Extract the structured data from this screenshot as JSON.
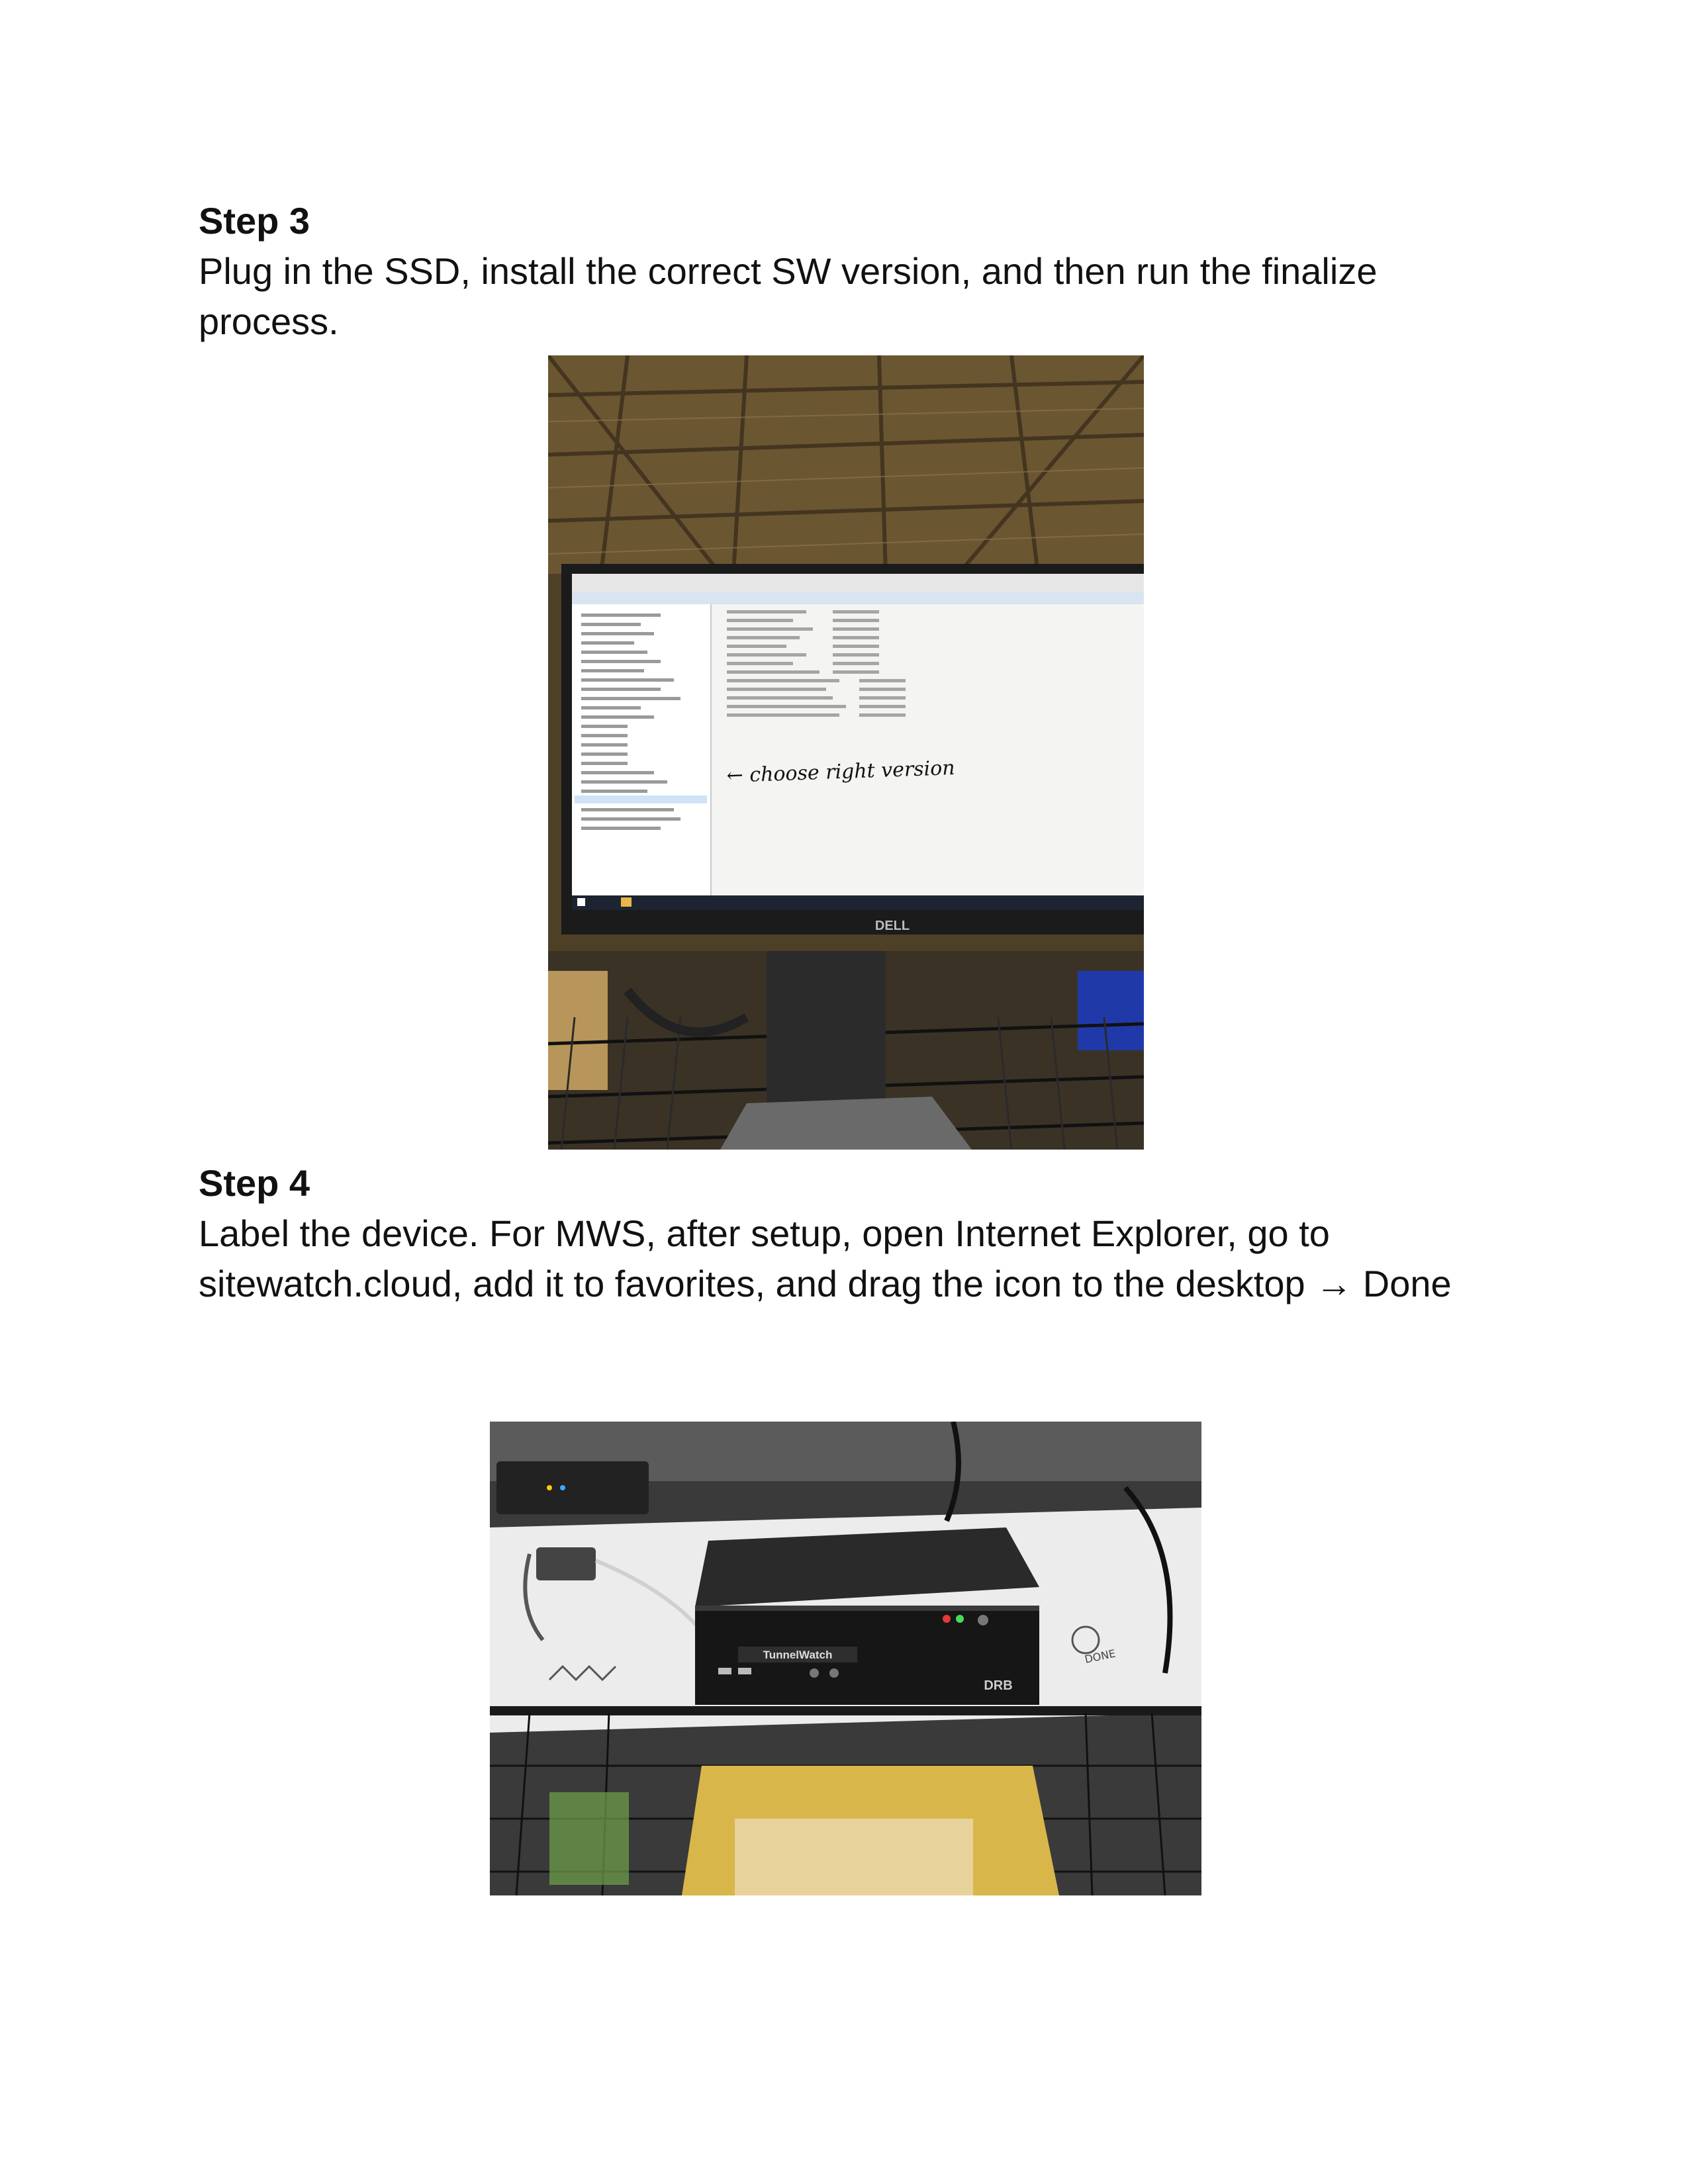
{
  "step3": {
    "heading": "Step 3",
    "text": "Plug in the SSD, install the correct SW version, and then run the finalize process.",
    "photo": {
      "annotation": "← choose right version",
      "monitor_brand": "DELL"
    }
  },
  "step4": {
    "heading": "Step 4",
    "text": "Label the device. For MWS, after setup, open Internet Explorer, go to sitewatch.cloud, add it to favorites, and drag the icon to the desktop → Done",
    "photo": {
      "device_label": "TunnelWatch",
      "device_brand": "DRB",
      "sticker_text": "DONE"
    }
  }
}
